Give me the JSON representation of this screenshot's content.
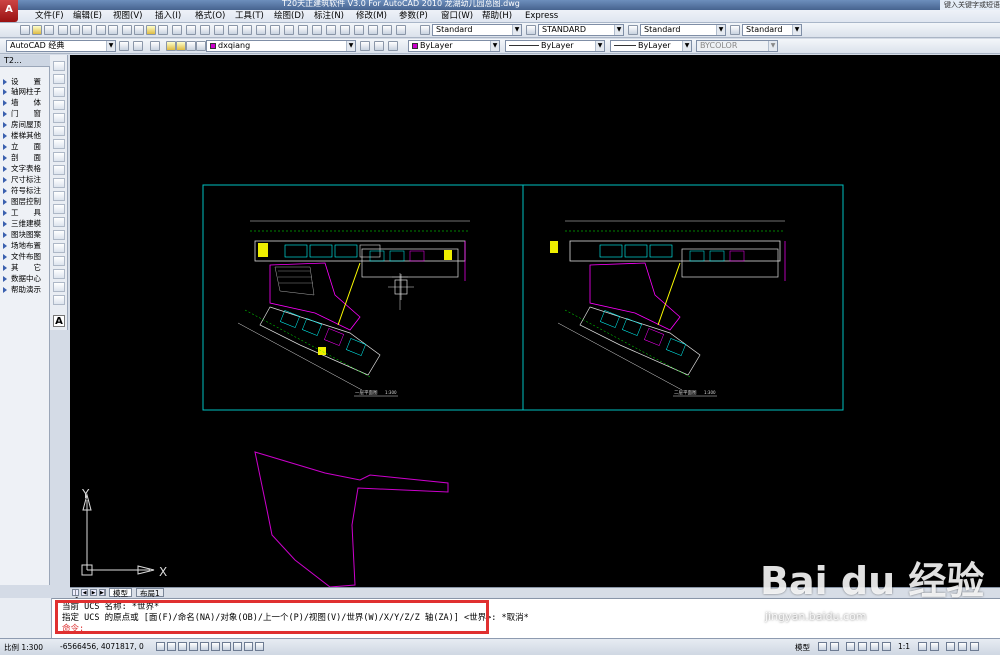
{
  "window": {
    "title": "T20天正建筑软件 V3.0 For AutoCAD 2010    龙湖幼儿园总图.dwg",
    "title_right": "键入关键字或短语"
  },
  "menu": {
    "items": [
      "文件(F)",
      "编辑(E)",
      "视图(V)",
      "插入(I)",
      "格式(O)",
      "工具(T)",
      "绘图(D)",
      "标注(N)",
      "修改(M)",
      "参数(P)",
      "窗口(W)",
      "帮助(H)",
      "Express"
    ]
  },
  "toolbar1": {
    "text_style": "Standard",
    "dim_style": "STANDARD",
    "table_style": "Standard",
    "mleader_style": "Standard"
  },
  "toolbar2": {
    "workspace": "AutoCAD 经典",
    "layer": "dxqiang",
    "color": "ByLayer",
    "linetype": "ByLayer",
    "lineweight": "ByLayer",
    "plotstyle": "BYCOLOR"
  },
  "left_panel": {
    "title": "T2...",
    "items": [
      "设　　置",
      "轴网柱子",
      "墙　　体",
      "门　　窗",
      "房间屋顶",
      "楼梯其他",
      "立　　面",
      "剖　　面",
      "文字表格",
      "尺寸标注",
      "符号标注",
      "图层控制",
      "工　　具",
      "三维建模",
      "图块图案",
      "场地布置",
      "文件布图",
      "其　　它",
      "数据中心",
      "帮助演示"
    ]
  },
  "canvas": {
    "axis_y": "Y",
    "axis_x": "X",
    "plan_left_title": "一层平面图",
    "plan_right_title": "二层平面图",
    "scale_label": "1:300"
  },
  "tabs": {
    "model": "模型",
    "layout1": "布局1"
  },
  "command": {
    "line1": "当前 UCS 名称: *世界*",
    "line2": "指定 UCS 的原点或 [面(F)/命名(NA)/对象(OB)/上一个(P)/视图(V)/世界(W)/X/Y/Z/Z 轴(ZA)] <世界>: *取消*",
    "line3": "命令:"
  },
  "status": {
    "scale": "比例 1:300",
    "coords": "-6566456, 4071817, 0",
    "model": "模型",
    "annotation_scale": "1:1"
  },
  "watermark": {
    "logo": "Bai du 经验",
    "url": "jingyan.baidu.com"
  }
}
